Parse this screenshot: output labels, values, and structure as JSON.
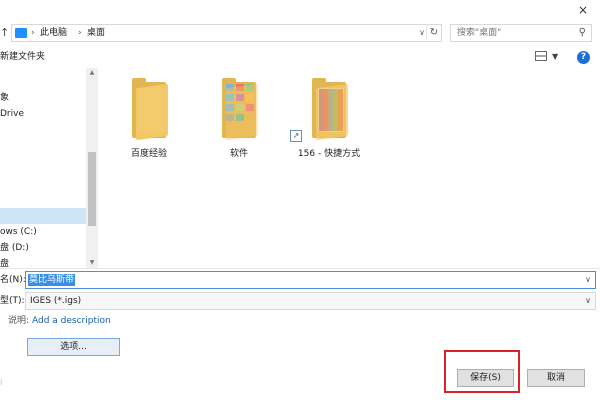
{
  "window": {
    "close_symbol": "×"
  },
  "address_bar": {
    "breadcrumbs": [
      "此电脑",
      "桌面"
    ],
    "separator": "›",
    "icon": "computer-icon"
  },
  "search": {
    "placeholder": "搜索\"桌面\""
  },
  "toolbar": {
    "new_folder_label": "新建文件夹"
  },
  "nav_pane": {
    "items": [
      {
        "label": "象",
        "selected": false
      },
      {
        "label": "Drive",
        "selected": false
      },
      {
        "label": "",
        "selected": true
      },
      {
        "label": "ows (C:)",
        "selected": false
      },
      {
        "label": "盘 (D:)",
        "selected": false
      },
      {
        "label": "盘",
        "selected": false
      }
    ]
  },
  "files": [
    {
      "label": "百度经验",
      "icon": "folder-icon"
    },
    {
      "label": "软件",
      "icon": "folder-thumbnails-icon"
    },
    {
      "label": "156 - 快捷方式",
      "icon": "folder-shortcut-icon"
    }
  ],
  "form": {
    "filename_label": "名(N):",
    "filename_value": "莫比乌斯带",
    "filetype_label": "型(T):",
    "filetype_value": "IGES (*.igs)",
    "description_label": "说明:",
    "description_link": "Add a description"
  },
  "buttons": {
    "options": "选项...",
    "save": "保存(S)",
    "cancel": "取消"
  },
  "colors": {
    "highlight": "#d8232a",
    "selection": "#3a8ee6",
    "folder": "#f3c967",
    "link": "#1a5fb4"
  }
}
